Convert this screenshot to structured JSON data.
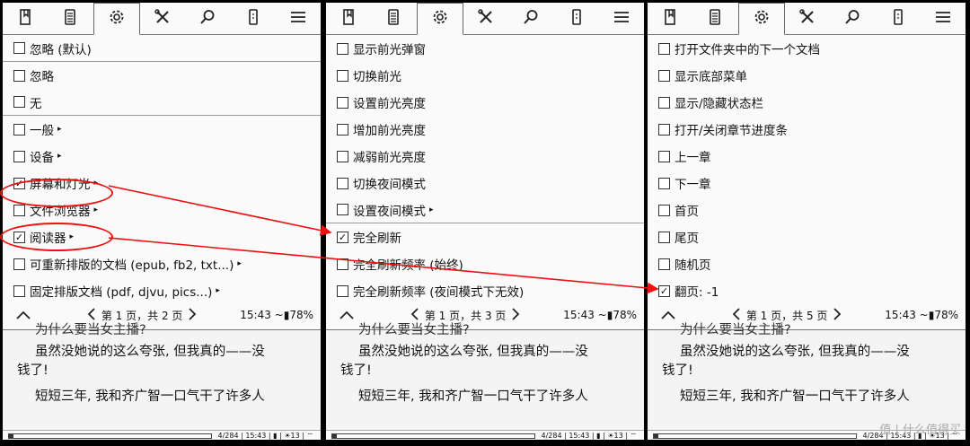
{
  "panels": [
    {
      "items": [
        {
          "label": "忽略 (默认)",
          "checked": false,
          "sub": false,
          "sep": true
        },
        {
          "label": "忽略",
          "checked": false,
          "sub": false,
          "sep": false
        },
        {
          "label": "无",
          "checked": false,
          "sub": false,
          "sep": true
        },
        {
          "label": "一般",
          "checked": false,
          "sub": true,
          "sep": false
        },
        {
          "label": "设备",
          "checked": false,
          "sub": true,
          "sep": false
        },
        {
          "label": "屏幕和灯光",
          "checked": true,
          "sub": true,
          "sep": false
        },
        {
          "label": "文件浏览器",
          "checked": false,
          "sub": true,
          "sep": false
        },
        {
          "label": "阅读器",
          "checked": true,
          "sub": true,
          "sep": false
        },
        {
          "label": "可重新排版的文档 (epub, fb2, txt...)",
          "checked": false,
          "sub": true,
          "sep": false
        },
        {
          "label": "固定排版文档 (pdf, djvu, pics...)",
          "checked": false,
          "sub": true,
          "sep": false
        }
      ],
      "page": "第 1 页，共 2 页",
      "time": "15:43 ~▮78%",
      "footer": "4/284 | 15:43 | ▮ | ☀13 | ⌔"
    },
    {
      "items": [
        {
          "label": "显示前光弹窗",
          "checked": false,
          "sub": false,
          "sep": false
        },
        {
          "label": "切换前光",
          "checked": false,
          "sub": false,
          "sep": false
        },
        {
          "label": "设置前光亮度",
          "checked": false,
          "sub": false,
          "sep": false
        },
        {
          "label": "增加前光亮度",
          "checked": false,
          "sub": false,
          "sep": false
        },
        {
          "label": "减弱前光亮度",
          "checked": false,
          "sub": false,
          "sep": false
        },
        {
          "label": "切换夜间模式",
          "checked": false,
          "sub": false,
          "sep": false
        },
        {
          "label": "设置夜间模式",
          "checked": false,
          "sub": true,
          "sep": true
        },
        {
          "label": "完全刷新",
          "checked": true,
          "sub": false,
          "sep": false
        },
        {
          "label": "完全刷新频率 (始终)",
          "checked": false,
          "sub": false,
          "sep": false
        },
        {
          "label": "完全刷新频率 (夜间模式下无效)",
          "checked": false,
          "sub": false,
          "sep": false
        }
      ],
      "page": "第 1 页，共 3 页",
      "time": "15:43 ~▮78%",
      "footer": "4/284 | 15:43 | ▮ | ☀13 | ⌔"
    },
    {
      "items": [
        {
          "label": "打开文件夹中的下一个文档",
          "checked": false,
          "sub": false,
          "sep": false
        },
        {
          "label": "显示底部菜单",
          "checked": false,
          "sub": false,
          "sep": false
        },
        {
          "label": "显示/隐藏状态栏",
          "checked": false,
          "sub": false,
          "sep": false
        },
        {
          "label": "打开/关闭章节进度条",
          "checked": false,
          "sub": false,
          "sep": false
        },
        {
          "label": "上一章",
          "checked": false,
          "sub": false,
          "sep": false
        },
        {
          "label": "下一章",
          "checked": false,
          "sub": false,
          "sep": false
        },
        {
          "label": "首页",
          "checked": false,
          "sub": false,
          "sep": false
        },
        {
          "label": "尾页",
          "checked": false,
          "sub": false,
          "sep": false
        },
        {
          "label": "随机页",
          "checked": false,
          "sub": false,
          "sep": false
        },
        {
          "label": "翻页: -1",
          "checked": true,
          "sub": false,
          "sep": false
        }
      ],
      "page": "第 1 页，共 5 页",
      "time": "15:43 ~▮78%",
      "footer": "4/284 | 15:43 | ▮ | ☀13 | ⌔"
    }
  ],
  "reader": {
    "line0": "为什么要当女主播?",
    "line1": "虽然没她说的这么夸张, 但我真的——没",
    "line2": "钱了!",
    "line3": "短短三年, 我和齐广智一口气干了许多人"
  },
  "watermark": "值 | 什么值得买",
  "colors": {
    "annotation": "#ee1111",
    "panel": "#fafafa",
    "frame": "#000000"
  }
}
